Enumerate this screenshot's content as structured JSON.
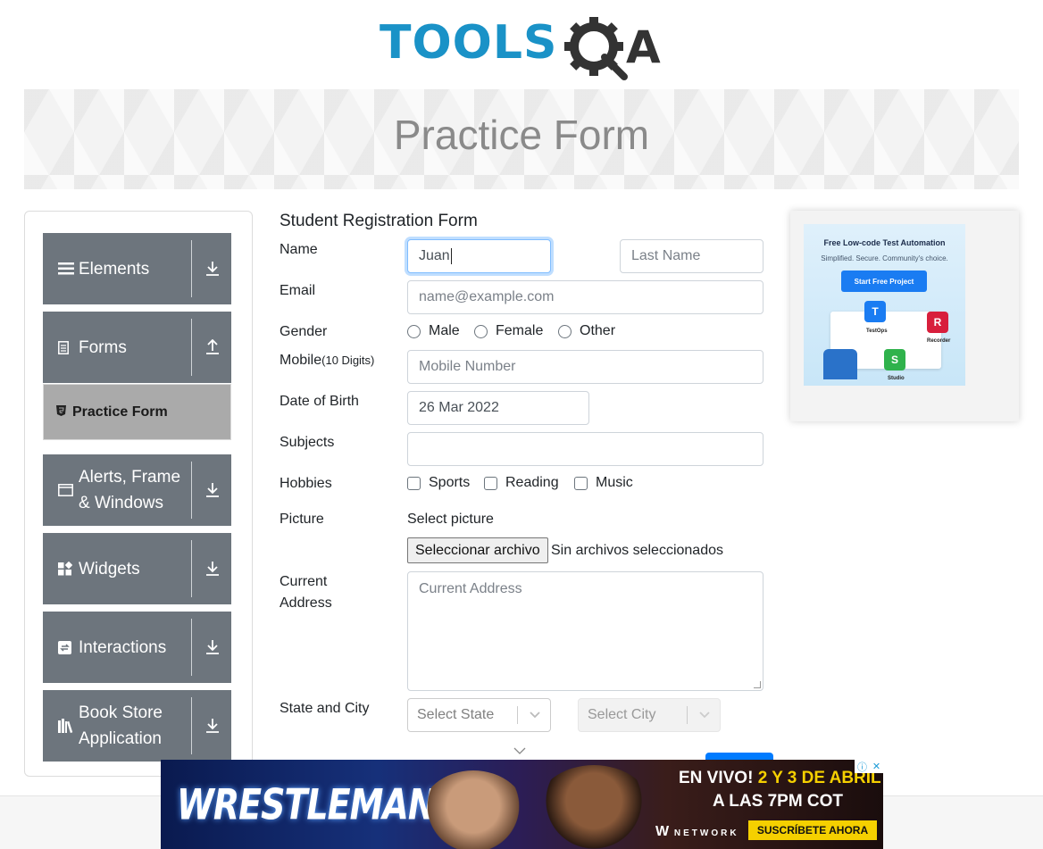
{
  "header": {
    "logo_text": "TOOLS",
    "logo_suffix": "QA"
  },
  "banner": {
    "title": "Practice Form"
  },
  "sidebar": {
    "groups": [
      {
        "label": "Elements",
        "icon": "list-icon",
        "arrow": "download-arrow"
      },
      {
        "label": "Forms",
        "icon": "document-icon",
        "arrow": "upload-arrow"
      },
      {
        "label": "Alerts, Frame & Windows",
        "icon": "window-icon",
        "arrow": "download-arrow"
      },
      {
        "label": "Widgets",
        "icon": "widgets-icon",
        "arrow": "download-arrow"
      },
      {
        "label": "Interactions",
        "icon": "interaction-icon",
        "arrow": "download-arrow"
      },
      {
        "label": "Book Store Application",
        "icon": "books-icon",
        "arrow": "download-arrow"
      }
    ],
    "active_item": {
      "label": "Practice Form",
      "icon": "html5-icon"
    }
  },
  "form": {
    "title": "Student Registration Form",
    "name": {
      "label": "Name",
      "first_value": "Juan",
      "last_placeholder": "Last Name"
    },
    "email": {
      "label": "Email",
      "placeholder": "name@example.com"
    },
    "gender": {
      "label": "Gender",
      "options": [
        "Male",
        "Female",
        "Other"
      ]
    },
    "mobile": {
      "label": "Mobile",
      "label_note": "(10 Digits)",
      "placeholder": "Mobile Number"
    },
    "dob": {
      "label": "Date of Birth",
      "value": "26 Mar 2022"
    },
    "subjects": {
      "label": "Subjects"
    },
    "hobbies": {
      "label": "Hobbies",
      "options": [
        "Sports",
        "Reading",
        "Music"
      ]
    },
    "picture": {
      "label": "Picture",
      "select_text": "Select picture",
      "button": "Seleccionar archivo",
      "status": "Sin archivos seleccionados"
    },
    "address": {
      "label_line1": "Current",
      "label_line2": "Address",
      "placeholder": "Current Address"
    },
    "state_city": {
      "label": "State and City",
      "state_placeholder": "Select State",
      "city_placeholder": "Select City"
    }
  },
  "side_ad": {
    "headline": "Free Low-code Test Automation",
    "sub": "Simplified. Secure. Community's choice.",
    "button": "Start Free Project",
    "apps": [
      "TestOps",
      "Recorder",
      "Studio"
    ]
  },
  "bottom_ad": {
    "brand": "WRESTLEMANIA",
    "line1_prefix": "EN VIVO!",
    "line1_highlight": "2 Y 3 DE ABRIL",
    "line2": "A LAS 7PM COT",
    "network": "NETWORK",
    "cta": "SUSCRÍBETE AHORA"
  },
  "colors": {
    "sidebar_bg": "#6d757d",
    "active_item_bg": "#aaaaaa",
    "logo_blue": "#1a92c7",
    "logo_dark": "#3c3c3c",
    "input_border": "#ced4da",
    "focus_border": "#80bdff"
  }
}
